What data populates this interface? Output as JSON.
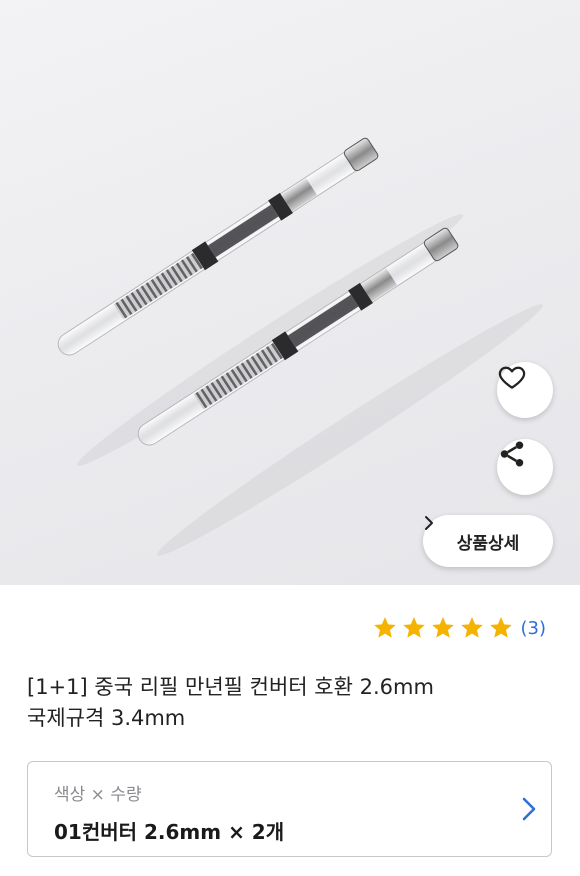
{
  "product": {
    "image_alt_icon": "fountain-pen-converter-image",
    "title_line1": "[1+1] 중국 리필 만년필 컨버터 호환 2.6mm",
    "title_line2": "국제규격 3.4mm"
  },
  "actions": {
    "wishlist_icon": "heart-icon",
    "share_icon": "share-icon",
    "detail_label": "상품상세",
    "detail_chevron": "›"
  },
  "rating": {
    "stars": 5,
    "max_stars": 5,
    "count_text": "(3)",
    "star_color": "#f5b301"
  },
  "option": {
    "label": "색상 × 수량",
    "value": "01컨버터 2.6mm × 2개",
    "chevron_color": "#2f6fd6"
  }
}
